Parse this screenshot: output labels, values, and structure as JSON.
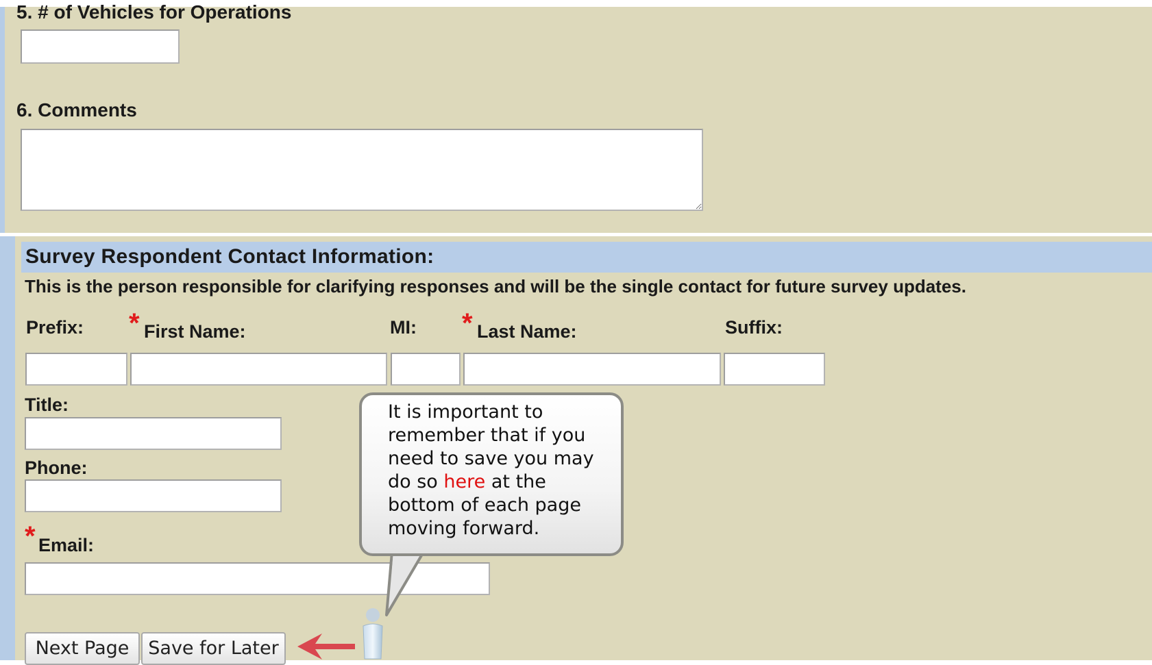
{
  "q5": {
    "label": "5. # of Vehicles for Operations",
    "value": ""
  },
  "q6": {
    "label": "6. Comments",
    "value": ""
  },
  "contact": {
    "heading": "Survey Respondent Contact Information:",
    "description": "This is the person responsible for clarifying responses and will be the single contact for future survey updates.",
    "required_marker": "*",
    "prefix_label": "Prefix:",
    "first_name_label": "First Name:",
    "mi_label": "MI:",
    "last_name_label": "Last Name:",
    "suffix_label": "Suffix:",
    "title_label": "Title:",
    "phone_label": "Phone:",
    "email_label": "Email:"
  },
  "buttons": {
    "next": "Next Page",
    "save": "Save for Later"
  },
  "callout": {
    "line1": "It is important to",
    "line2": "remember that if you",
    "line3": "need to save you may",
    "line4_pre": "do so ",
    "line4_highlight": "here",
    "line4_post": " at the",
    "line5": "bottom of each page",
    "line6": "moving forward."
  },
  "colors": {
    "panel": "#ddd9bb",
    "header": "#b7cde8",
    "required": "#e01c1c",
    "arrow": "#d9474f"
  }
}
